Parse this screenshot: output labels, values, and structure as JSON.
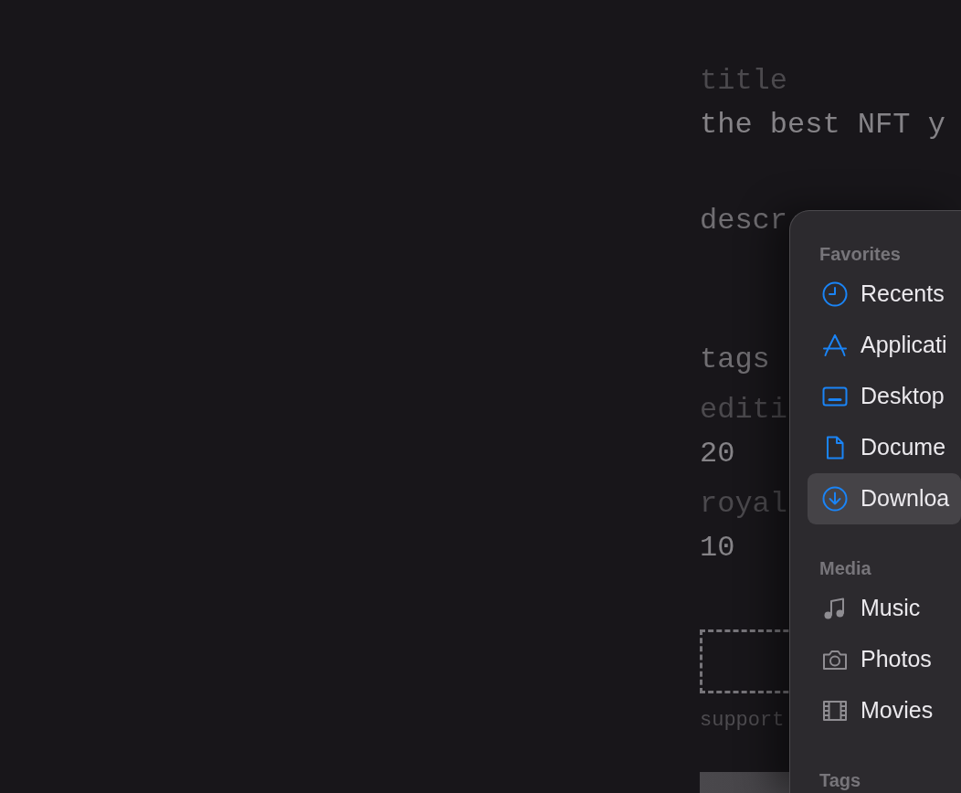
{
  "form": {
    "fields": [
      {
        "kind": "text",
        "label": "title",
        "value": "the best NFT y"
      },
      {
        "kind": "textarea",
        "placeholder": "descr"
      },
      {
        "kind": "text",
        "placeholder": "tags"
      },
      {
        "kind": "text",
        "label": "editi",
        "value": "20"
      },
      {
        "kind": "text",
        "label": "royal",
        "value": "10"
      }
    ],
    "dropzone": {
      "hint": "support"
    }
  },
  "file_dialog": {
    "sidebar": {
      "sections": [
        {
          "title": "Favorites",
          "items": [
            {
              "label": "Recents",
              "selected": false
            },
            {
              "label": "Applicati",
              "selected": false
            },
            {
              "label": "Desktop",
              "selected": false
            },
            {
              "label": "Docume",
              "selected": false
            },
            {
              "label": "Downloa",
              "selected": true
            }
          ]
        },
        {
          "title": "Media",
          "items": [
            {
              "label": "Music",
              "selected": false
            },
            {
              "label": "Photos",
              "selected": false
            },
            {
              "label": "Movies",
              "selected": false
            }
          ]
        },
        {
          "title": "Tags"
        }
      ]
    }
  }
}
